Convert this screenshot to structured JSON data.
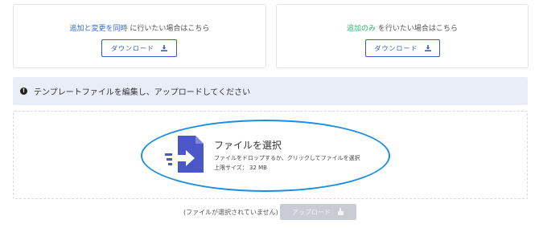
{
  "cards": {
    "left": {
      "highlight": "追加と変更を同時",
      "rest": " に行いたい場合はこちら",
      "button_label": "ダウンロード",
      "highlight_color": "#3b6fd6"
    },
    "right": {
      "highlight": "追加のみ",
      "rest": " を行いたい場合はこちら",
      "button_label": "ダウンロード",
      "highlight_color": "#2bb673"
    }
  },
  "info": {
    "icon": "exclamation-circle-icon",
    "text": "テンプレートファイルを編集し、アップロードしてください"
  },
  "dropzone": {
    "title": "ファイルを選択",
    "description": "ファイルをドロップするか、クリックしてファイルを選択",
    "limit": "上限サイズ： 32 MB",
    "icon": "file-import-icon",
    "icon_color": "#4b57c9",
    "highlight_ring_color": "#1a8fdf"
  },
  "footer": {
    "status": "(ファイルが選択されていません)",
    "upload_label": "アップロード",
    "upload_icon": "hand-pointer-icon"
  }
}
